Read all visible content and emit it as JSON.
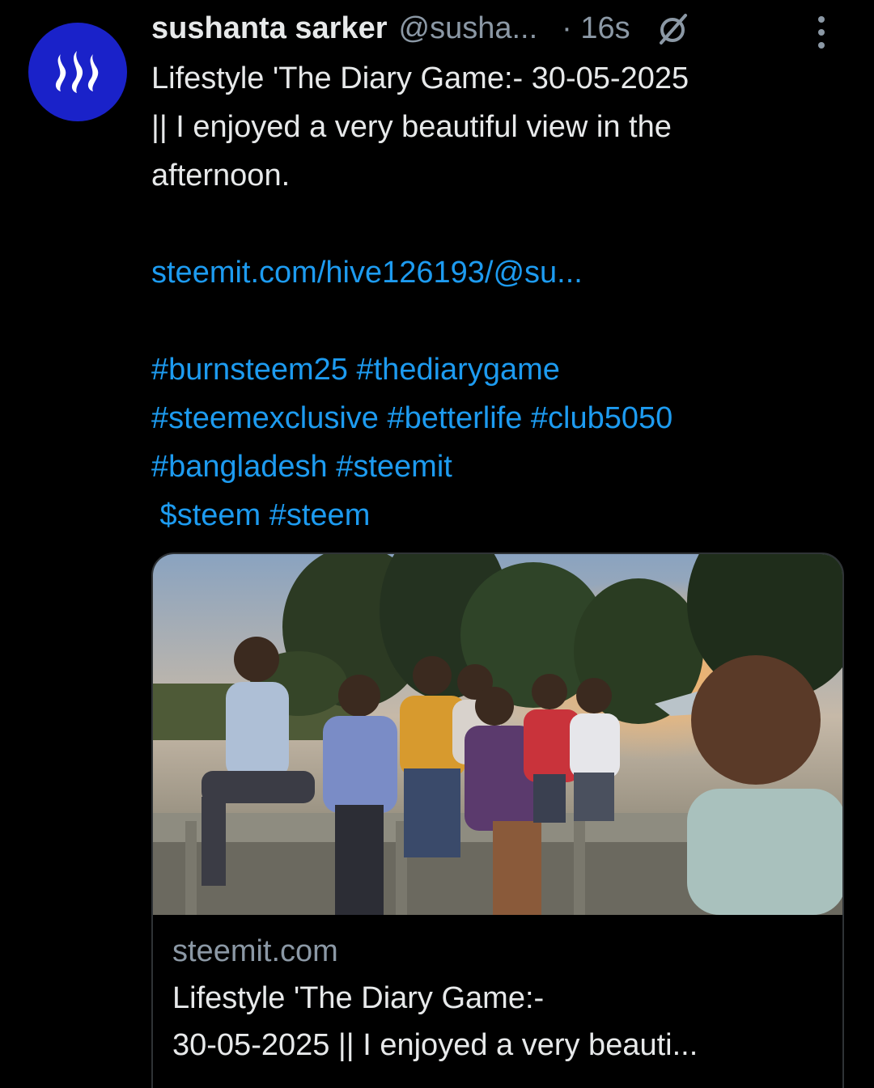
{
  "tweet": {
    "author_name": "sushanta sarker",
    "author_handle": "@susha...",
    "time": "· 16s",
    "text_line1": "Lifestyle 'The Diary Game:- 30-05-2025",
    "text_line2": "|| I enjoyed a very beautiful view in the",
    "text_line3": "afternoon.",
    "link": "steemit.com/hive126193/@su...",
    "hashtags_line1": "#burnsteem25 #thediarygame",
    "hashtags_line2": "#steemexclusive #betterlife #club5050",
    "hashtags_line3": "#bangladesh #steemit",
    "hashtags_line4": " $steem #steem"
  },
  "card": {
    "domain": "steemit.com",
    "title_line1": "Lifestyle 'The Diary Game:-",
    "title_line2": "30-05-2025 || I enjoyed a very beauti..."
  },
  "icons": {
    "avatar": "steem-logo-icon",
    "grok": "grok-icon",
    "more": "more-vertical-icon"
  },
  "colors": {
    "background": "#000000",
    "text": "#e7e9ea",
    "muted": "#8b98a5",
    "link": "#1d9bf0",
    "avatar_bg": "#1a22c9"
  }
}
